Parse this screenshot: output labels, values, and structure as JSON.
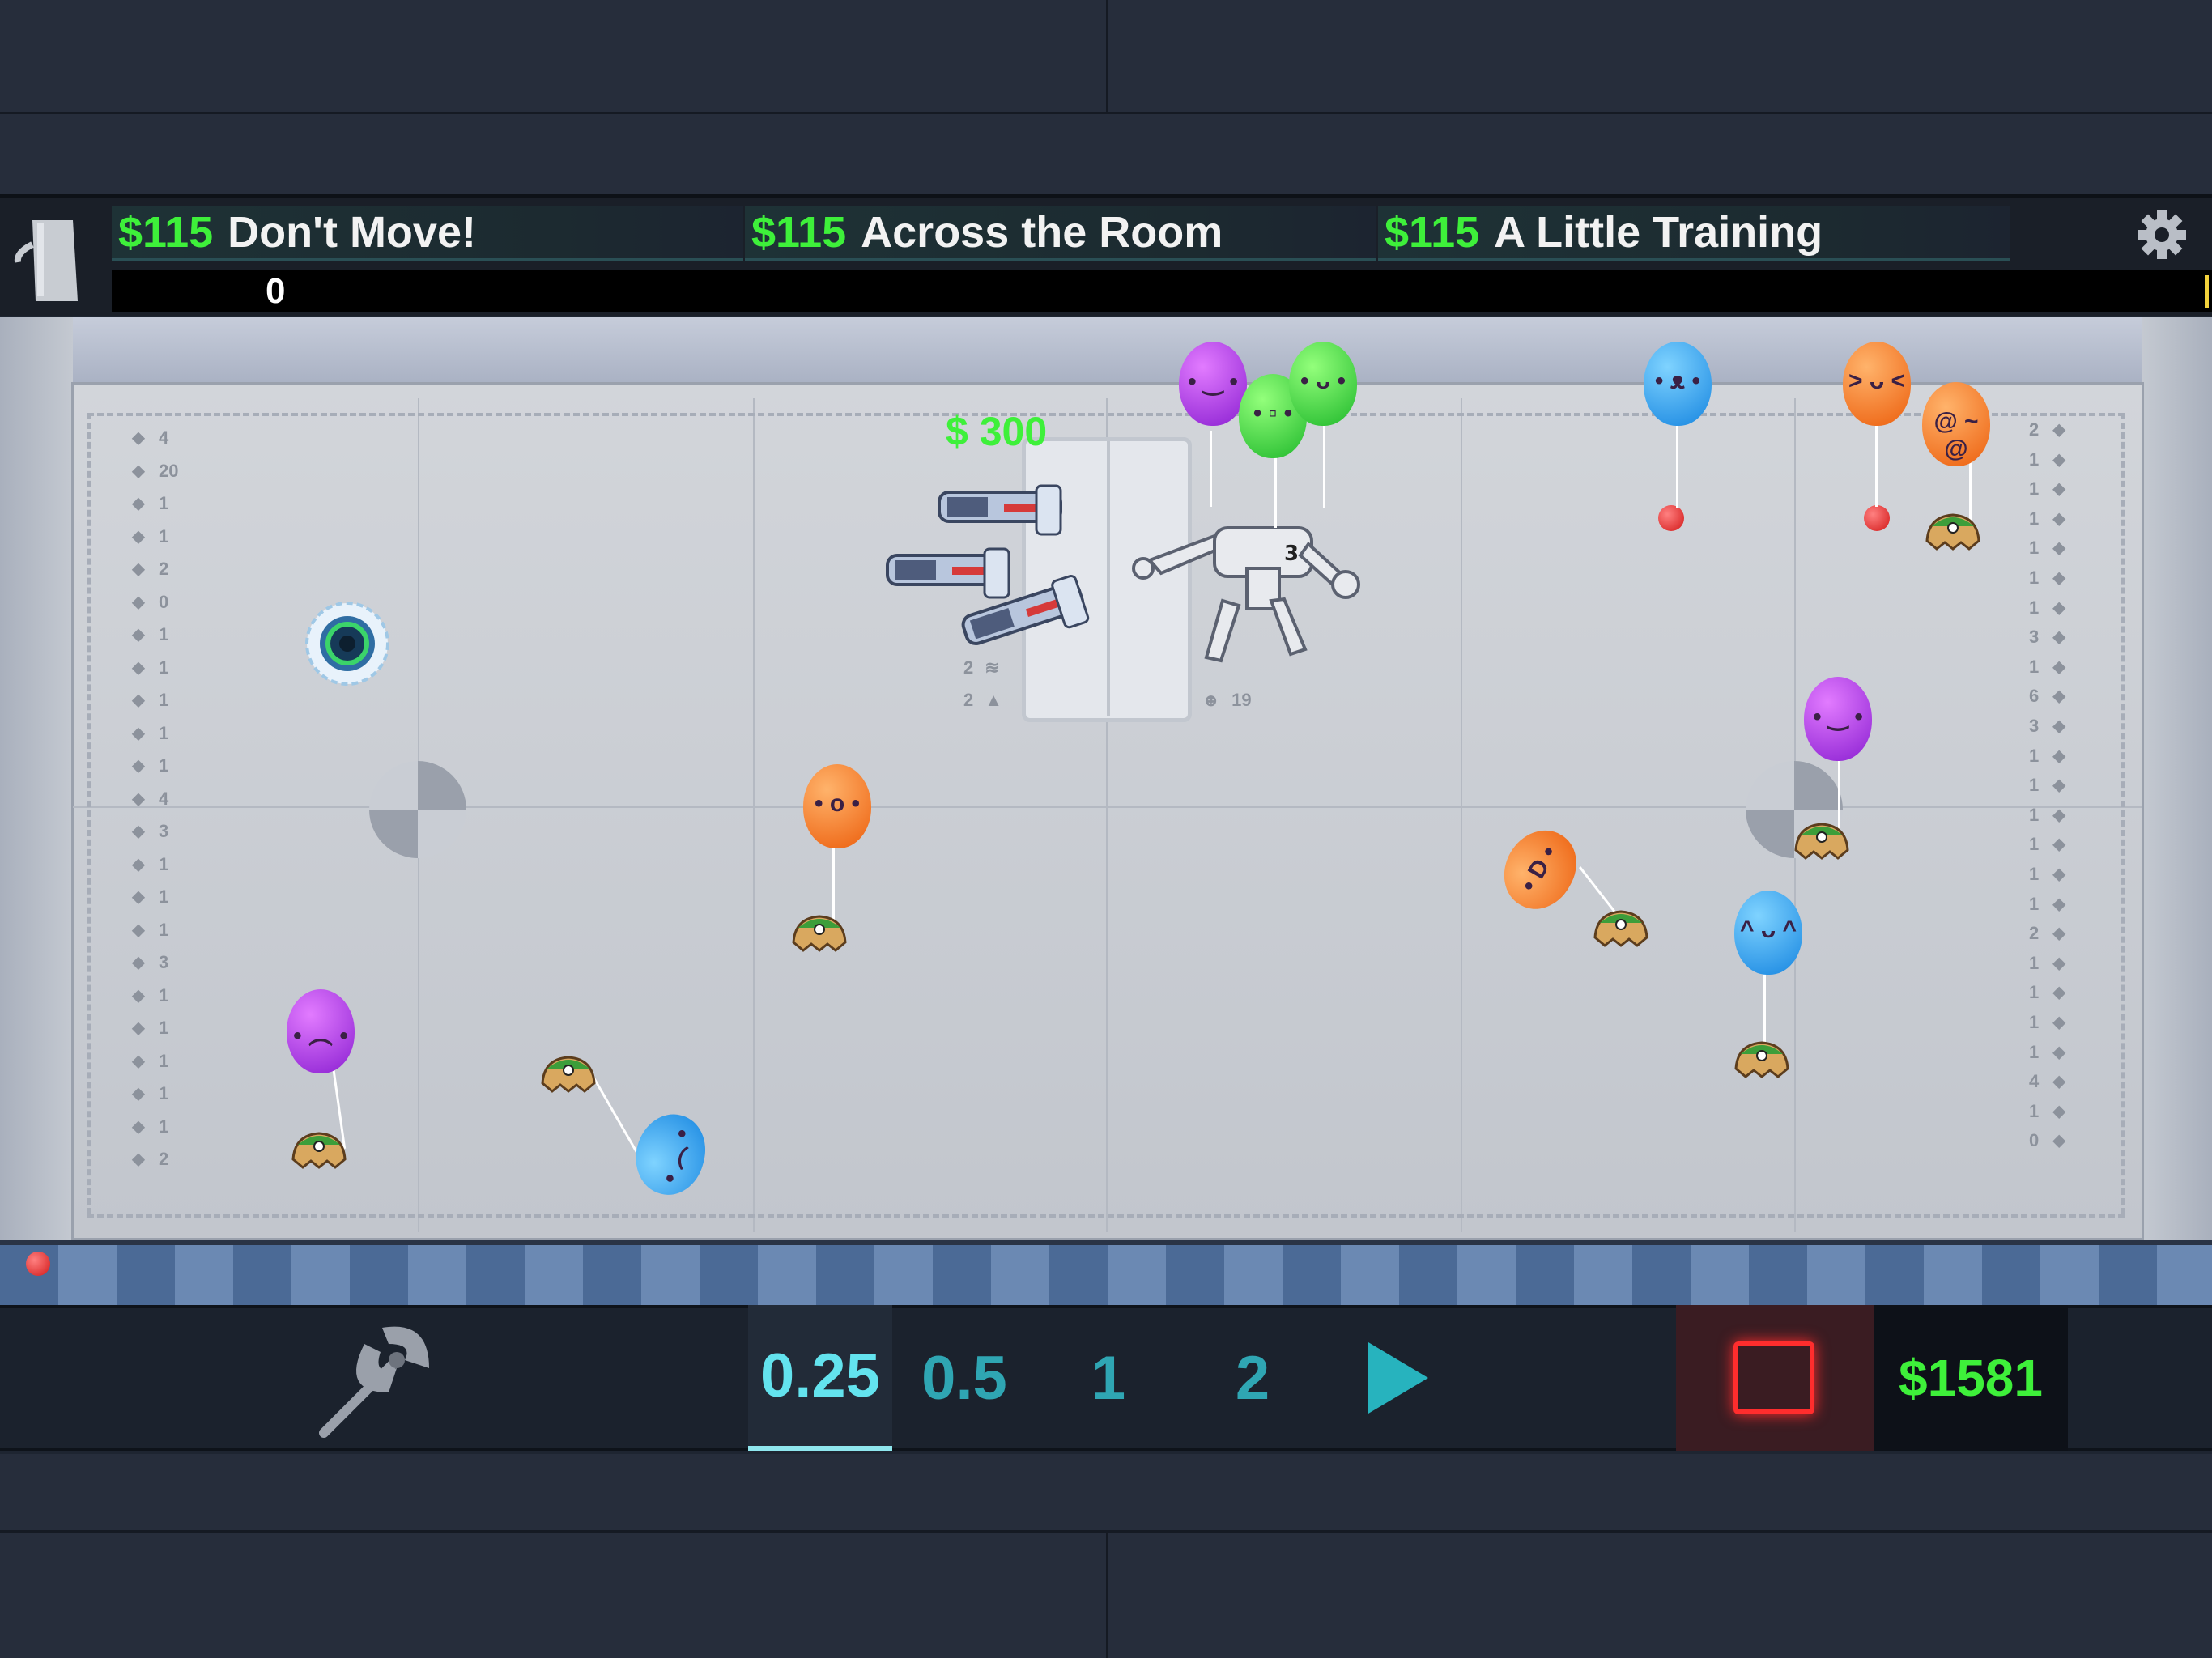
{
  "missions": [
    {
      "price": "$115",
      "name": "Don't Move!"
    },
    {
      "price": "$115",
      "name": "Across the Room"
    },
    {
      "price": "$115",
      "name": "A Little Training"
    }
  ],
  "progress": {
    "value_label": "0"
  },
  "floating_reward": "$ 300",
  "robot_counter": {
    "kills_label": "19",
    "item_a_label": "2",
    "item_b_label": "2"
  },
  "inventory_left": [
    {
      "icon": "hat-icon",
      "count": "4"
    },
    {
      "icon": "stack-icon",
      "count": "20"
    },
    {
      "icon": "bars-icon",
      "count": "1"
    },
    {
      "icon": "anchor-icon",
      "count": "1"
    },
    {
      "icon": "gear-icon",
      "count": "2"
    },
    {
      "icon": "box-icon",
      "count": "0"
    },
    {
      "icon": "wand-icon",
      "count": "1"
    },
    {
      "icon": "knife-icon",
      "count": "1"
    },
    {
      "icon": "figure-icon",
      "count": "1"
    },
    {
      "icon": "stick-icon",
      "count": "1"
    },
    {
      "icon": "brain-icon",
      "count": "1"
    },
    {
      "icon": "drop-icon",
      "count": "4"
    },
    {
      "icon": "frame-icon",
      "count": "3"
    },
    {
      "icon": "shell-icon",
      "count": "1"
    },
    {
      "icon": "spring-icon",
      "count": "1"
    },
    {
      "icon": "claw-icon",
      "count": "1"
    },
    {
      "icon": "pick-icon",
      "count": "3"
    },
    {
      "icon": "splat-icon",
      "count": "1"
    },
    {
      "icon": "bug-icon",
      "count": "1"
    },
    {
      "icon": "blade-icon",
      "count": "1"
    },
    {
      "icon": "hammer-icon",
      "count": "1"
    },
    {
      "icon": "star-icon",
      "count": "1"
    },
    {
      "icon": "claw2-icon",
      "count": "2"
    }
  ],
  "inventory_right": [
    {
      "icon": "spark-icon",
      "count": "2"
    },
    {
      "icon": "water-icon",
      "count": "1"
    },
    {
      "icon": "bolt-icon",
      "count": "1"
    },
    {
      "icon": "rope-icon",
      "count": "1"
    },
    {
      "icon": "sword-icon",
      "count": "1"
    },
    {
      "icon": "arrow-icon",
      "count": "1"
    },
    {
      "icon": "flower-icon",
      "count": "1"
    },
    {
      "icon": "burst-icon",
      "count": "3"
    },
    {
      "icon": "speaker-icon",
      "count": "1"
    },
    {
      "icon": "feather-icon",
      "count": "6"
    },
    {
      "icon": "lightning-icon",
      "count": "3"
    },
    {
      "icon": "mine-icon",
      "count": "1"
    },
    {
      "icon": "brain2-icon",
      "count": "1"
    },
    {
      "icon": "barrel-icon",
      "count": "1"
    },
    {
      "icon": "disc-icon",
      "count": "1"
    },
    {
      "icon": "crate-icon",
      "count": "1"
    },
    {
      "icon": "cog-icon",
      "count": "1"
    },
    {
      "icon": "rod-icon",
      "count": "2"
    },
    {
      "icon": "smile-icon",
      "count": "1"
    },
    {
      "icon": "drum-icon",
      "count": "1"
    },
    {
      "icon": "bulb-icon",
      "count": "1"
    },
    {
      "icon": "blob-icon",
      "count": "1"
    },
    {
      "icon": "slug-icon",
      "count": "4"
    },
    {
      "icon": "boot-icon",
      "count": "1"
    },
    {
      "icon": "cube-icon",
      "count": "0"
    }
  ],
  "speeds": [
    {
      "label": "0.25",
      "active": true
    },
    {
      "label": "0.5",
      "active": false
    },
    {
      "label": "1",
      "active": false
    },
    {
      "label": "2",
      "active": false
    }
  ],
  "money": "$1581",
  "colors": {
    "accent_green": "#3ef03a",
    "speed_active": "#63e3ee",
    "stop_red": "#ff2d2d"
  },
  "icons": {
    "menu": "bucket-icon",
    "settings": "gear-icon",
    "tool": "battle-axe-icon",
    "play": "play-icon",
    "stop": "stop-icon"
  }
}
